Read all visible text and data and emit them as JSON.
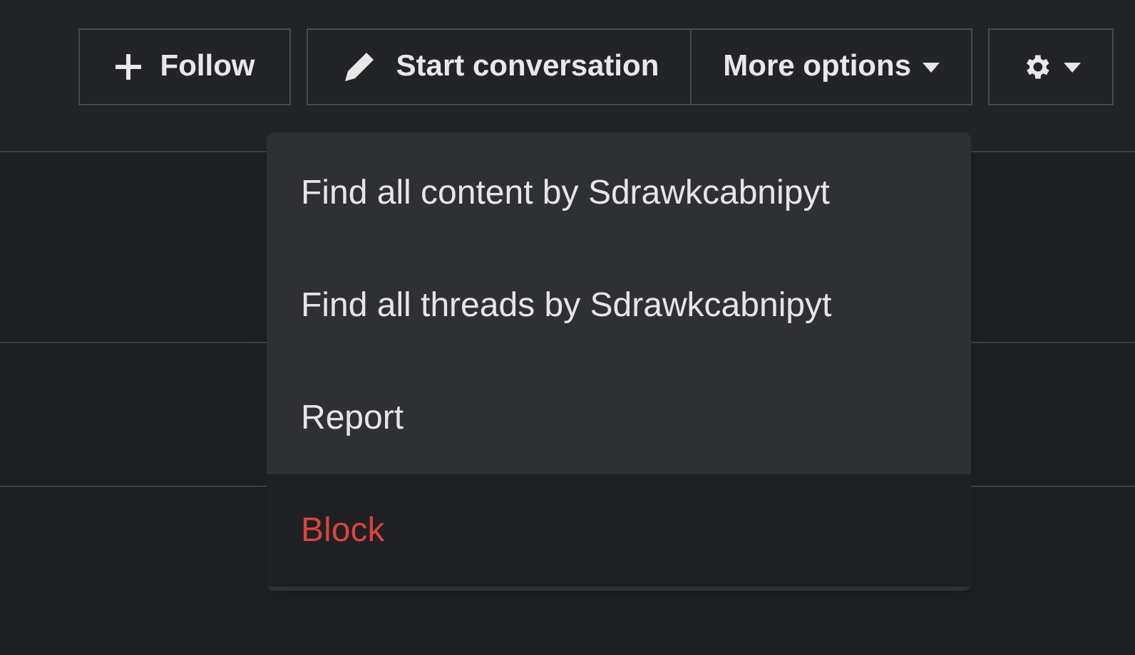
{
  "toolbar": {
    "follow": {
      "label": "Follow"
    },
    "conversation": {
      "label": "Start conversation"
    },
    "more": {
      "label": "More options"
    }
  },
  "menu": {
    "items": [
      {
        "label": "Find all content by Sdrawkcabnipyt",
        "kind": "normal",
        "selected": false
      },
      {
        "label": "Find all threads by Sdrawkcabnipyt",
        "kind": "normal",
        "selected": false
      },
      {
        "label": "Report",
        "kind": "normal",
        "selected": false
      },
      {
        "label": "Block",
        "kind": "danger",
        "selected": true
      }
    ]
  }
}
